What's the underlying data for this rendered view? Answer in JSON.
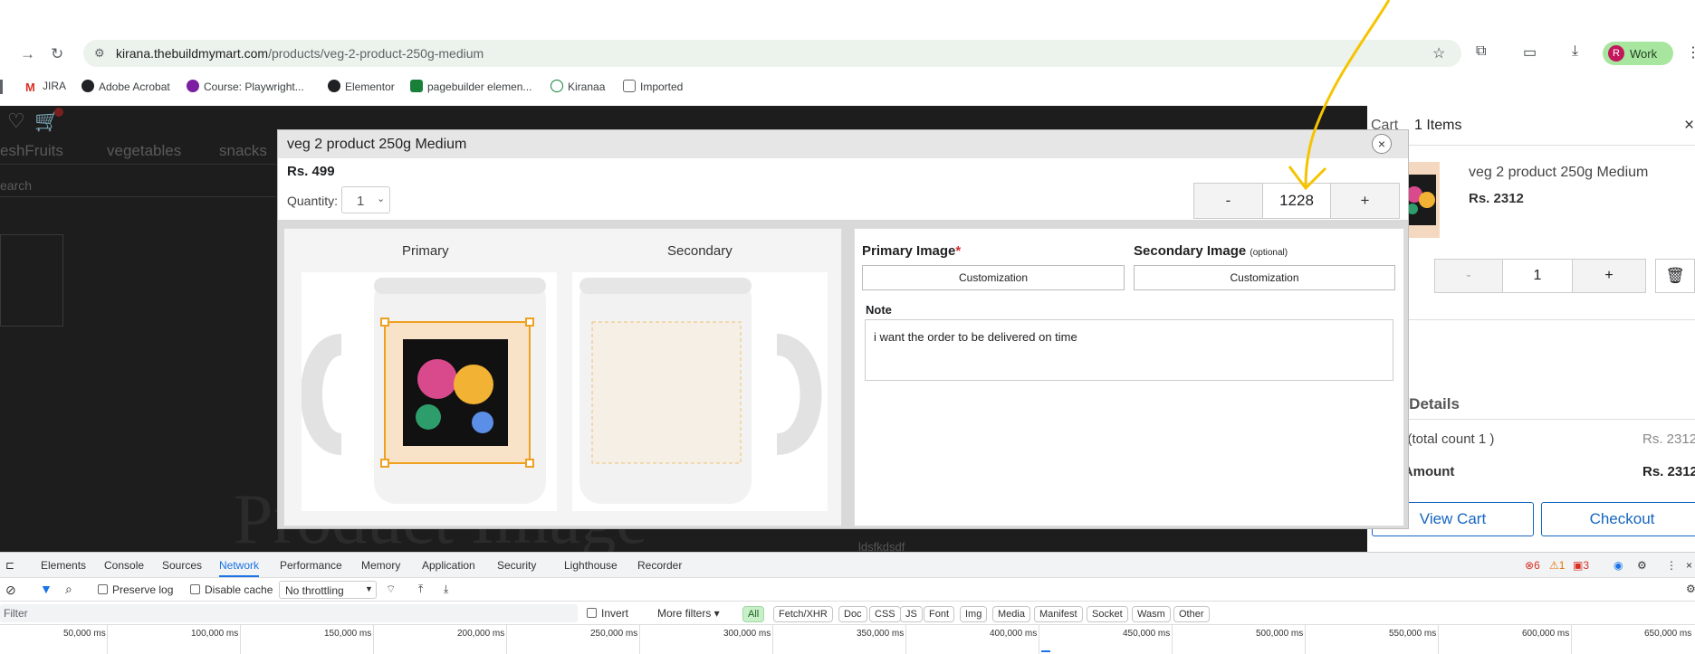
{
  "browser": {
    "url_host": "kirana.thebuildmymart.com",
    "url_path": "/products/veg-2-product-250g-medium",
    "profile_initial": "R",
    "profile_label": "Work",
    "bookmarks": [
      {
        "label": "JIRA",
        "color": "#d93025"
      },
      {
        "label": "Adobe Acrobat",
        "color": "#202124"
      },
      {
        "label": "Course: Playwright...",
        "color": "#7b1fa2"
      },
      {
        "label": "Elementor",
        "color": "#202124"
      },
      {
        "label": "pagebuilder elemen...",
        "color": "#188038"
      },
      {
        "label": "Kiranaa",
        "color": "#188038"
      },
      {
        "label": "Imported",
        "color": "#5f6368"
      }
    ]
  },
  "page": {
    "nav_freshfruits": "eshFruits",
    "nav_vegetables": "vegetables",
    "nav_snacks": "snacks",
    "search_partial": "earch",
    "ghost_title": "Product Image",
    "below_text": "ldsfkdsdf"
  },
  "modal": {
    "title": "veg 2 product 250g Medium",
    "price": "Rs. 499",
    "quantity_label": "Quantity:",
    "quantity_value": "1",
    "stepper_minus": "-",
    "stepper_value": "1228",
    "stepper_plus": "+",
    "close": "×",
    "primary_label": "Primary",
    "secondary_label": "Secondary",
    "primary_image_label": "Primary Image",
    "required_mark": "*",
    "secondary_image_label": "Secondary Image",
    "optional_label": "(optional)",
    "customization_label": "Customization",
    "note_label": "Note",
    "note_value": "i want the order to be delivered on time"
  },
  "cart": {
    "title_partial": "Cart",
    "items_count": "1 Items",
    "close": "×",
    "item_name": "veg 2 product 250g Medium",
    "item_price": "Rs. 2312",
    "qty_minus": "-",
    "qty_value": "1",
    "qty_plus": "+",
    "details_header": "e Details",
    "total_count_label": "e (total count 1 )",
    "total_count_value": "Rs. 2312",
    "amount_label": "l Amount",
    "amount_value": "Rs. 2312",
    "view_cart": "View Cart",
    "checkout": "Checkout"
  },
  "devtools": {
    "tabs": [
      "Elements",
      "Console",
      "Sources",
      "Network",
      "Performance",
      "Memory",
      "Application",
      "Security",
      "Lighthouse",
      "Recorder"
    ],
    "active_tab": "Network",
    "errors": "6",
    "warnings": "1",
    "issues": "3",
    "preserve_log": "Preserve log",
    "disable_cache": "Disable cache",
    "throttling": "No throttling",
    "filter_placeholder": "Filter",
    "invert": "Invert",
    "more_filters": "More filters",
    "filter_chips": [
      "All",
      "Fetch/XHR",
      "Doc",
      "CSS",
      "JS",
      "Font",
      "Img",
      "Media",
      "Manifest",
      "Socket",
      "Wasm",
      "Other"
    ],
    "timeline_ticks": [
      "50,000 ms",
      "100,000 ms",
      "150,000 ms",
      "200,000 ms",
      "250,000 ms",
      "300,000 ms",
      "350,000 ms",
      "400,000 ms",
      "450,000 ms",
      "500,000 ms",
      "550,000 ms",
      "600,000 ms",
      "650,000 ms"
    ]
  },
  "colors": {
    "accent_blue": "#1565c0",
    "annotation_arrow": "#f5c400",
    "required_red": "#d32f2f"
  }
}
